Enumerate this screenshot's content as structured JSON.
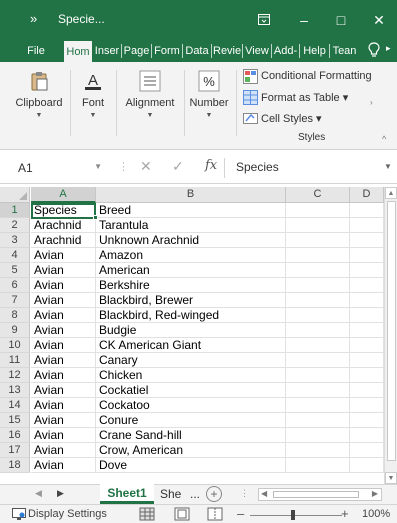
{
  "window": {
    "title": "Specie...",
    "chevron": "»",
    "minimize": "–",
    "maximize": "□",
    "close": "✕"
  },
  "ribbon_tabs": [
    {
      "label": "File",
      "active": false
    },
    {
      "label": "Hom",
      "active": true
    },
    {
      "label": "Inser",
      "active": false
    },
    {
      "label": "Page",
      "active": false
    },
    {
      "label": "Form",
      "active": false
    },
    {
      "label": "Data",
      "active": false
    },
    {
      "label": "Revie",
      "active": false
    },
    {
      "label": "View",
      "active": false
    },
    {
      "label": "Add-",
      "active": false
    },
    {
      "label": "Help",
      "active": false
    },
    {
      "label": "Tean",
      "active": false
    }
  ],
  "ribbon": {
    "clipboard": "Clipboard",
    "font": "Font",
    "alignment": "Alignment",
    "number": "Number",
    "conditional_formatting": "Conditional Formatting",
    "format_as_table": "Format as Table",
    "cell_styles": "Cell Styles",
    "styles_group": "Styles"
  },
  "formula_bar": {
    "name_box": "A1",
    "fx": "fx",
    "content": "Species"
  },
  "sheet": {
    "columns": [
      "A",
      "B",
      "C",
      "D"
    ],
    "rows": [
      {
        "num": "1",
        "a": "Species",
        "b": "Breed"
      },
      {
        "num": "2",
        "a": "Arachnid",
        "b": "Tarantula"
      },
      {
        "num": "3",
        "a": "Arachnid",
        "b": "Unknown Arachnid"
      },
      {
        "num": "4",
        "a": "Avian",
        "b": "Amazon"
      },
      {
        "num": "5",
        "a": "Avian",
        "b": "American"
      },
      {
        "num": "6",
        "a": "Avian",
        "b": "Berkshire"
      },
      {
        "num": "7",
        "a": "Avian",
        "b": "Blackbird, Brewer"
      },
      {
        "num": "8",
        "a": "Avian",
        "b": "Blackbird, Red-winged"
      },
      {
        "num": "9",
        "a": "Avian",
        "b": "Budgie"
      },
      {
        "num": "10",
        "a": "Avian",
        "b": "CK American Giant"
      },
      {
        "num": "11",
        "a": "Avian",
        "b": "Canary"
      },
      {
        "num": "12",
        "a": "Avian",
        "b": "Chicken"
      },
      {
        "num": "13",
        "a": "Avian",
        "b": "Cockatiel"
      },
      {
        "num": "14",
        "a": "Avian",
        "b": "Cockatoo"
      },
      {
        "num": "15",
        "a": "Avian",
        "b": "Conure"
      },
      {
        "num": "16",
        "a": "Avian",
        "b": "Crane Sand-hill"
      },
      {
        "num": "17",
        "a": "Avian",
        "b": "Crow, American"
      },
      {
        "num": "18",
        "a": "Avian",
        "b": "Dove"
      }
    ]
  },
  "sheet_tabs": {
    "active": "Sheet1",
    "second": "She",
    "more": "...",
    "add": "+"
  },
  "status_bar": {
    "display_settings": "Display Settings",
    "zoom": "100%",
    "minus": "–",
    "plus": "+"
  },
  "colors": {
    "accent": "#217346",
    "ribbon_bg": "#f3f3f3",
    "header_bg": "#e6e6e6"
  }
}
